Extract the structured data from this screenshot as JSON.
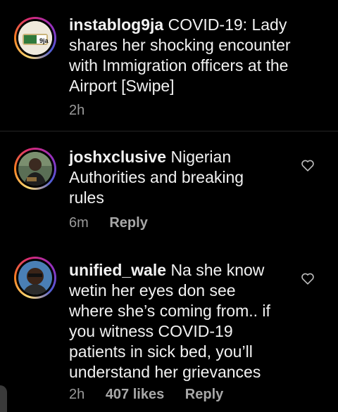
{
  "caption": {
    "username": "instablog9ja",
    "text": "COVID-19: Lady shares her shocking encounter with Immigration officers at the Airport [Swipe]",
    "time": "2h",
    "avatar_logo": "9ja"
  },
  "comments": [
    {
      "username": "joshxclusive",
      "text": "Nigerian Authorities and breaking rules",
      "time": "6m",
      "reply_label": "Reply"
    },
    {
      "username": "unified_wale",
      "text": "Na she know wetin her eyes don see where she’s coming from.. if you witness COVID-19 patients in sick bed, you’ll understand her grievances",
      "time": "2h",
      "likes": "407 likes",
      "reply_label": "Reply"
    }
  ],
  "icons": {
    "like": "heart-outline-icon"
  },
  "colors": {
    "background": "#000000",
    "text": "#f2f2f2",
    "meta": "#9a9a9a"
  }
}
